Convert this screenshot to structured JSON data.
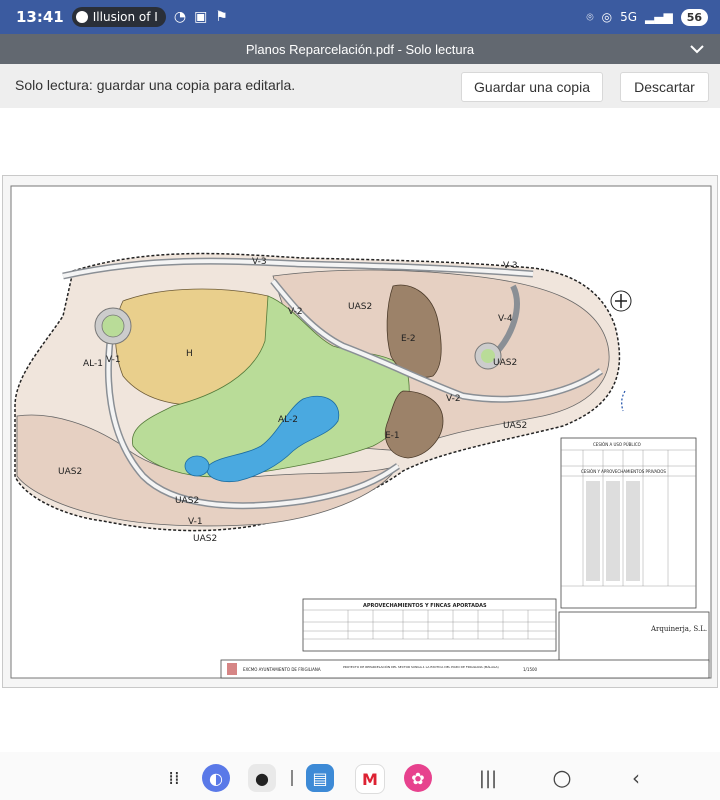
{
  "status_bar": {
    "time": "13:41",
    "media_title": "Illusion of I",
    "network": "5G",
    "battery": "56"
  },
  "title_bar": {
    "title": "Planos Reparcelación.pdf - Solo lectura"
  },
  "readonly_bar": {
    "message": "Solo lectura: guardar una copia para editarla.",
    "save_copy_label": "Guardar una copia",
    "discard_label": "Descartar"
  },
  "document": {
    "zone_labels": [
      "V-3",
      "V-3",
      "V-2",
      "V-4",
      "V-2",
      "V-1",
      "V-1",
      "AL-1",
      "AL-2",
      "E-1",
      "E-2",
      "H",
      "UAS2",
      "UAS2",
      "UAS2",
      "UAS2",
      "UAS2",
      "UAS2"
    ],
    "table_title": "APROVECHAMIENTOS Y FINCAS APORTADAS",
    "side_table_title": "CESIÓN A USO PÚBLICO",
    "side_table_subtitle": "CESIÓN Y APROVECHAMIENTOS PRIVADOS",
    "company": "Arquinerja, S.L.",
    "footer_authority": "EXCMO AYUNTAMIENTO DE FRIGILIANA",
    "footer_project": "PROYECTO DE REPARCELACIÓN DEL SECTOR SUNGA-1 LA EXOTICA DEL POZO DE FRIGILIANA (MÁLAGA)",
    "scale": "1/1500"
  },
  "colors": {
    "status_bar": "#3b5ba0",
    "title_bar": "#626870",
    "readonly_bar": "#eeeeee",
    "plan_parcel": "#e8d2c4",
    "plan_green": "#b9dc98",
    "plan_yellow": "#e9cf8c",
    "plan_water": "#4aa9e0",
    "plan_brown": "#9c8269"
  }
}
